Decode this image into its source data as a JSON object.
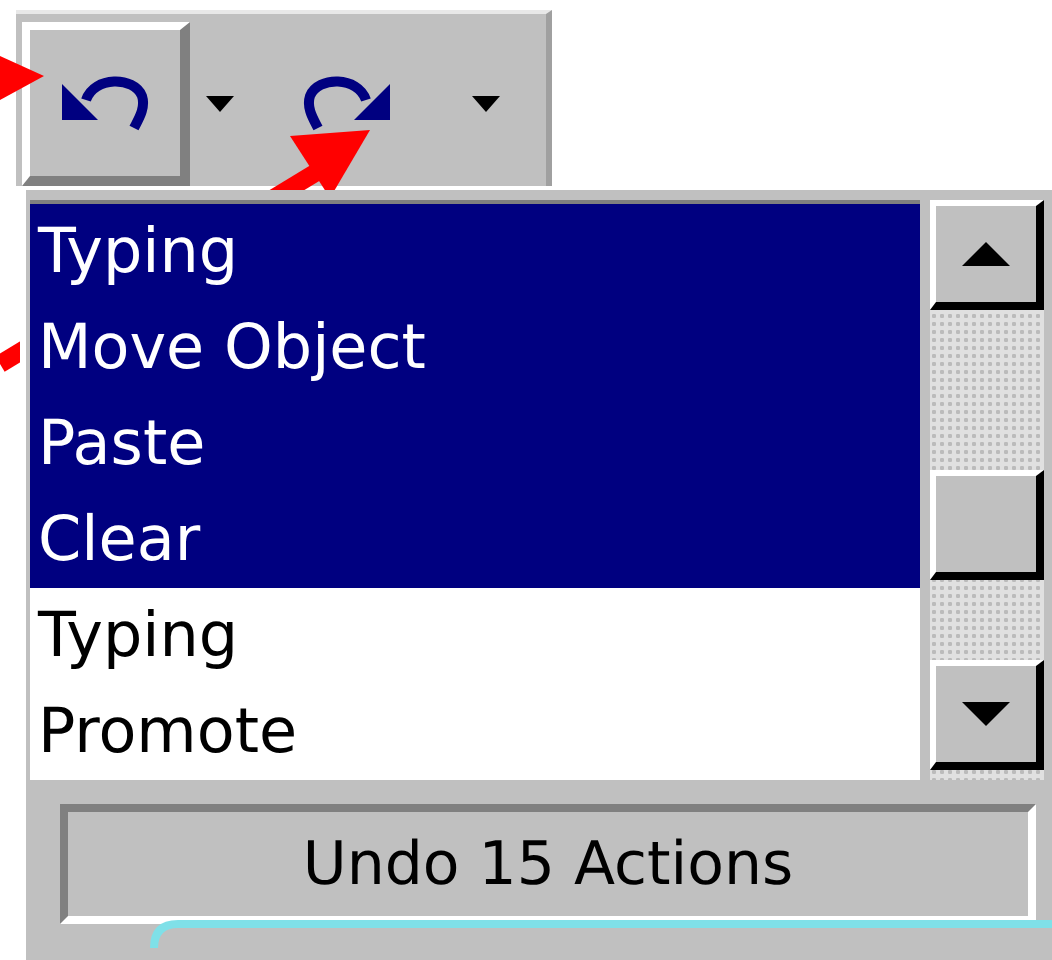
{
  "toolbar": {
    "undo": {
      "pressed": true
    },
    "redo": {
      "pressed": false
    }
  },
  "undo_list": {
    "items": [
      {
        "label": "Typing",
        "selected": true
      },
      {
        "label": "Move Object",
        "selected": true
      },
      {
        "label": "Paste",
        "selected": true
      },
      {
        "label": "Clear",
        "selected": true
      },
      {
        "label": "Typing",
        "selected": false
      },
      {
        "label": "Promote",
        "selected": false
      }
    ]
  },
  "status_button": {
    "label": "Undo 15 Actions"
  }
}
